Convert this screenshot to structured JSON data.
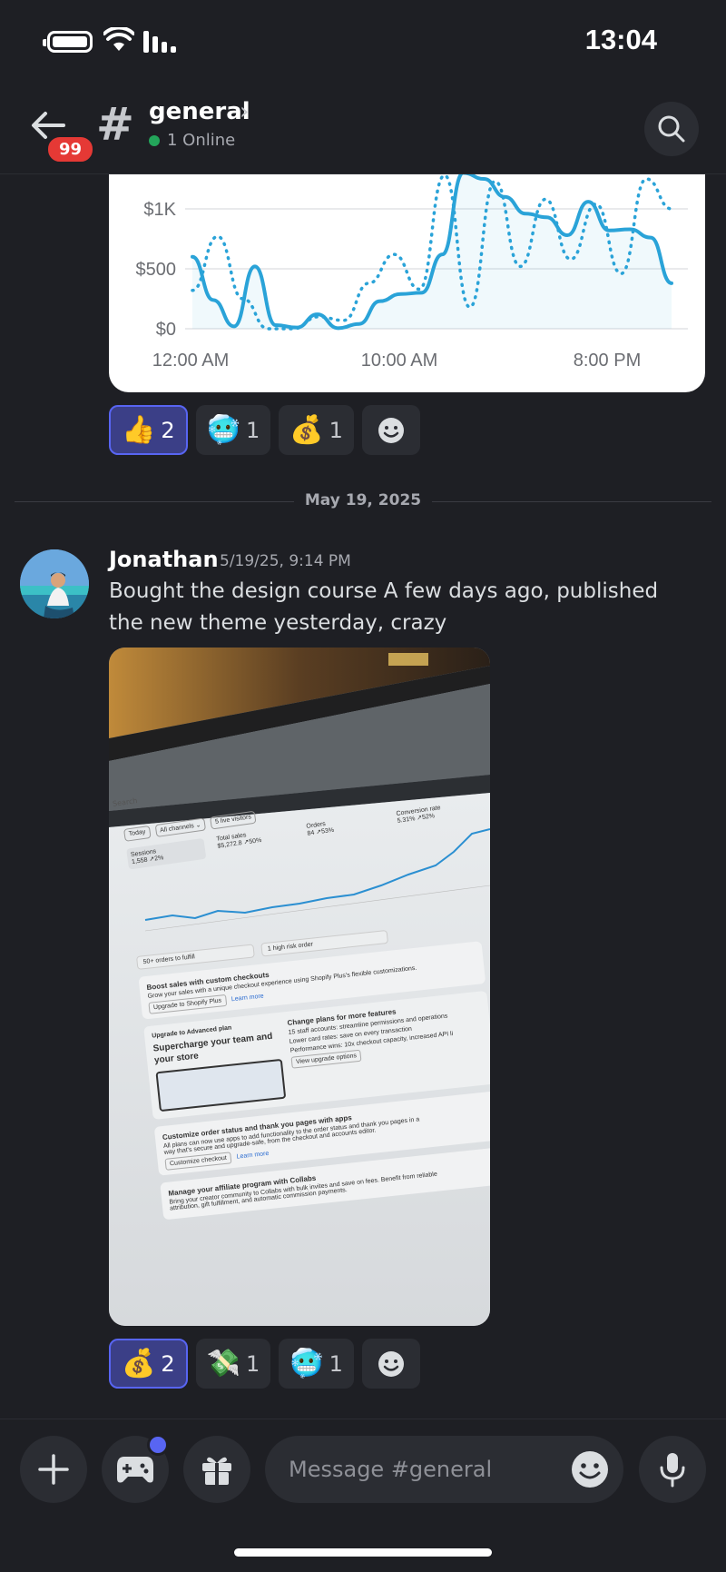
{
  "status_bar": {
    "time": "13:04"
  },
  "header": {
    "back_badge": "99",
    "channel_hash": "#",
    "channel_name": "general",
    "online_text": "1 Online"
  },
  "chart_data": {
    "type": "line",
    "y_ticks": [
      "$1K",
      "$500",
      "$0"
    ],
    "x_ticks": [
      "12:00 AM",
      "10:00 AM",
      "8:00 PM"
    ],
    "series": [
      {
        "style": "solid",
        "color": "#2aa3d8",
        "values": [
          600,
          240,
          20,
          520,
          30,
          10,
          120,
          5,
          40,
          230,
          290,
          300,
          620,
          1300,
          1250,
          1100,
          960,
          930,
          780,
          1060,
          820,
          830,
          760,
          380
        ]
      },
      {
        "style": "dotted",
        "color": "#2aa3d8",
        "values": [
          320,
          770,
          250,
          0,
          0,
          100,
          70,
          380,
          620,
          330,
          1280,
          180,
          1230,
          520,
          1080,
          580,
          1040,
          460,
          1250,
          1000
        ]
      }
    ],
    "ylim": [
      0,
      1300
    ]
  },
  "reactions_1": [
    {
      "emoji": "👍",
      "count": "2",
      "active": true
    },
    {
      "emoji": "🥶",
      "count": "1",
      "active": false
    },
    {
      "emoji": "💰",
      "count": "1",
      "active": false
    }
  ],
  "date_divider": "May 19, 2025",
  "message": {
    "author": "Jonathan",
    "timestamp": "5/19/25, 9:14 PM",
    "text": "Bought the design course A few days ago, published the new theme yesterday, crazy",
    "photo": {
      "search": "Search",
      "filters": [
        "Today",
        "All channels ⌄",
        "5 live visitors"
      ],
      "metrics": [
        {
          "label": "Sessions",
          "value": "1,558 ↗2%"
        },
        {
          "label": "Total sales",
          "value": "$5,272.8 ↗50%"
        },
        {
          "label": "Orders",
          "value": "84 ↗53%"
        },
        {
          "label": "Conversion rate",
          "value": "5.31% ↗52%"
        }
      ],
      "todo_orders": "50+ orders to fulfill",
      "todo_risk": "1 high risk order",
      "boost_title": "Boost sales with custom checkouts",
      "boost_text": "Grow your sales with a unique checkout experience using Shopify Plus's flexible customizations.",
      "boost_btn": "Upgrade to Shopify Plus",
      "boost_link": "Learn more",
      "upgrade_title": "Upgrade to Advanced plan",
      "upgrade_headline": "Supercharge your team and your store",
      "change_title": "Change plans for more features",
      "change_items": [
        "15 staff accounts: streamline permissions and operations",
        "Lower card rates: save on every transaction",
        "Performance wins: 10x checkout capacity, increased API li"
      ],
      "change_btn": "View upgrade options",
      "custom_title": "Customize order status and thank you pages with apps",
      "custom_text": "All plans can now use apps to add functionality to the order status and thank you pages in a way that's secure and upgrade-safe, from the checkout and accounts editor.",
      "custom_btn": "Customize checkout",
      "custom_link": "Learn more",
      "affiliate_title": "Manage your affiliate program with Collabs",
      "affiliate_text": "Bring your creator community to Collabs with bulk invites and save on fees. Benefit from reliable attribution, gift fulfillment, and automatic commission payments."
    }
  },
  "reactions_2": [
    {
      "emoji": "💰",
      "count": "2",
      "active": true
    },
    {
      "emoji": "💸",
      "count": "1",
      "active": false
    },
    {
      "emoji": "🥶",
      "count": "1",
      "active": false
    }
  ],
  "composer": {
    "placeholder": "Message #general"
  }
}
